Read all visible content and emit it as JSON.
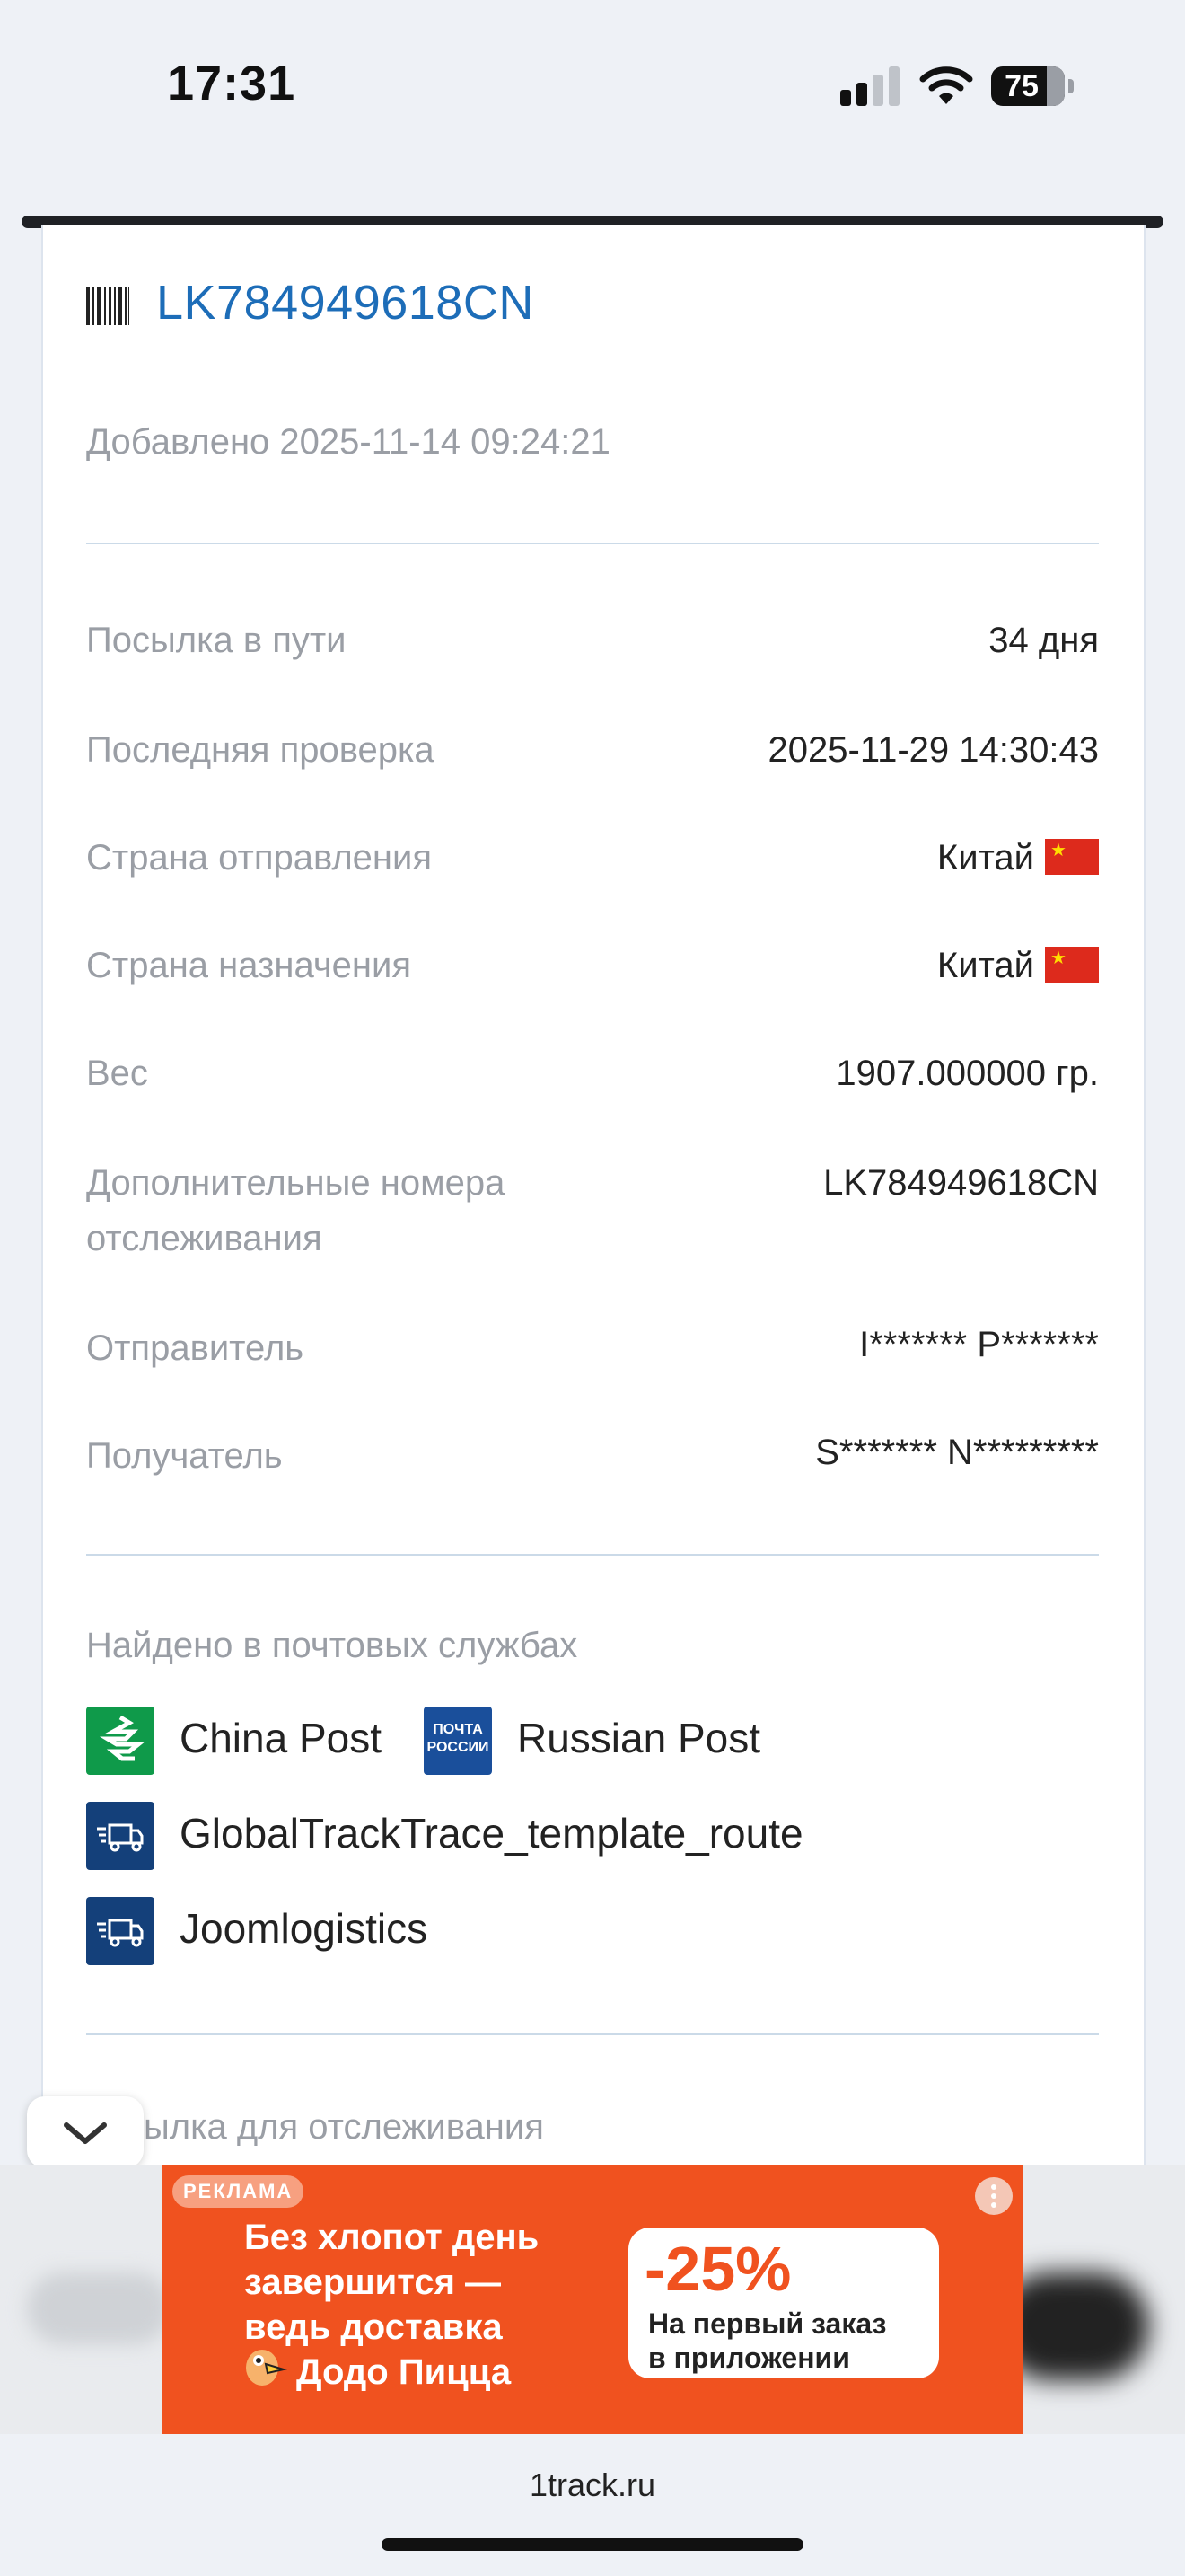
{
  "status_bar": {
    "time": "17:31",
    "battery": "75"
  },
  "header": {
    "tracking_number": "LK784949618CN",
    "added": "Добавлено 2025-11-14 09:24:21"
  },
  "details": [
    {
      "label": "Посылка в пути",
      "value": "34 дня"
    },
    {
      "label": "Последняя проверка",
      "value": "2025-11-29 14:30:43"
    },
    {
      "label": "Страна отправления",
      "value": "Китай",
      "flag": "china-flag"
    },
    {
      "label": "Страна назначения",
      "value": "Китай",
      "flag": "china-flag"
    },
    {
      "label": "Вес",
      "value": "1907.000000 гр."
    },
    {
      "label_line1": "Дополнительные номера",
      "label_line2": "отслеживания",
      "value": "LK784949618CN"
    },
    {
      "label": "Отправитель",
      "value": "I******* P*******"
    },
    {
      "label": "Получатель",
      "value": "S******* N*********"
    }
  ],
  "services": {
    "title": "Найдено в почтовых службах",
    "items": [
      {
        "name": "China Post",
        "icon": "china-post-logo",
        "color": "#0f9a4a"
      },
      {
        "name": "Russian Post",
        "icon": "russian-post-logo",
        "logo_text_1": "ПОЧТА",
        "logo_text_2": "РОССИИ",
        "color": "#1a4f9b"
      },
      {
        "name": "GlobalTrackTrace_template_route",
        "icon": "truck-icon",
        "color": "#14407a"
      },
      {
        "name": "Joomlogistics",
        "icon": "truck-icon",
        "color": "#14407a"
      }
    ]
  },
  "next_section": {
    "partial_label": "ылка для отслеживания"
  },
  "ad": {
    "badge": "РЕКЛАМА",
    "line1": "Без хлопот день",
    "line2": "завершится —",
    "line3": "ведь доставка",
    "line4": "Додо Пицца",
    "discount": "-25%",
    "offer_line1": "На первый заказ",
    "offer_line2": "в приложении",
    "color": "#f0521f"
  },
  "browser": {
    "url": "1track.ru"
  }
}
